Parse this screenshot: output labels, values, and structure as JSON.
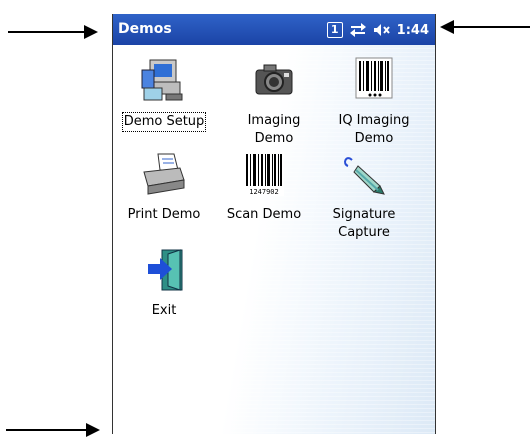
{
  "window": {
    "title": "Demos",
    "status_badge": "1",
    "time": "1:44"
  },
  "icons": {
    "sync": "sync-arrows-icon",
    "volume": "speaker-muted-icon"
  },
  "items": [
    {
      "label": "Demo Setup",
      "icon": "computer-setup-icon"
    },
    {
      "label": "Imaging\nDemo",
      "icon": "camera-icon"
    },
    {
      "label": "IQ Imaging\nDemo",
      "icon": "barcode-icon"
    },
    {
      "label": "Print Demo",
      "icon": "printer-icon"
    },
    {
      "label": "Scan Demo",
      "icon": "barcode-scan-icon"
    },
    {
      "label": "Signature\nCapture",
      "icon": "pen-signature-icon"
    },
    {
      "label": "Exit",
      "icon": "exit-door-icon"
    }
  ],
  "barcode_number": "1247902"
}
